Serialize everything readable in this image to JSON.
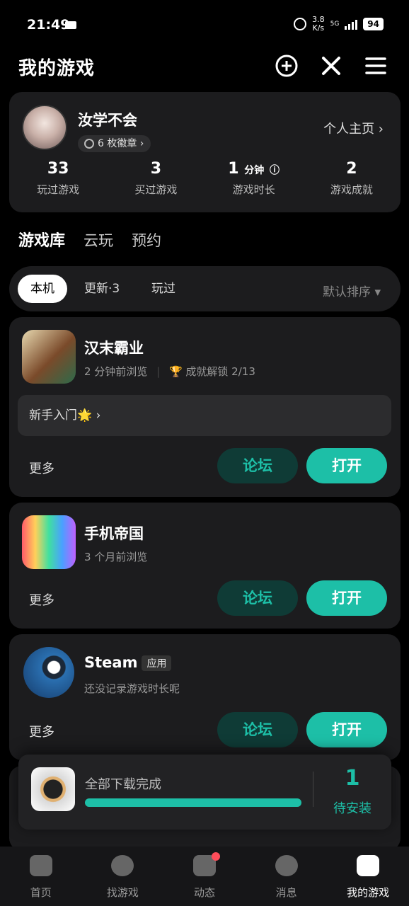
{
  "status": {
    "time": "21:49",
    "speed_top": "3.8",
    "speed_bottom": "K/s",
    "net": "5G",
    "battery": "94"
  },
  "header": {
    "title": "我的游戏"
  },
  "profile": {
    "name": "汝学不会",
    "badge": "6 枚徽章",
    "home_link": "个人主页",
    "stats": [
      {
        "value": "33",
        "unit": "",
        "label": "玩过游戏"
      },
      {
        "value": "3",
        "unit": "",
        "label": "买过游戏"
      },
      {
        "value": "1",
        "unit": "分钟",
        "label": "游戏时长"
      },
      {
        "value": "2",
        "unit": "",
        "label": "游戏成就"
      }
    ]
  },
  "tabs": [
    "游戏库",
    "云玩",
    "预约"
  ],
  "filters": {
    "local": "本机",
    "updates": "更新·3",
    "played": "玩过",
    "sort": "默认排序"
  },
  "games": [
    {
      "name": "汉末霸业",
      "sub": "2 分钟前浏览",
      "achievement": "成就解锁 2/13",
      "guide": "新手入门🌟",
      "more": "更多",
      "forum": "论坛",
      "open": "打开"
    },
    {
      "name": "手机帝国",
      "sub": "3 个月前浏览",
      "more": "更多",
      "forum": "论坛",
      "open": "打开"
    },
    {
      "name": "Steam",
      "tag": "应用",
      "sub": "还没记录游戏时长呢",
      "more": "更多",
      "forum": "论坛",
      "open": "打开"
    }
  ],
  "download": {
    "text": "全部下载完成",
    "progress": 1.0,
    "count": "1",
    "count_label": "待安装"
  },
  "nav": [
    {
      "label": "首页"
    },
    {
      "label": "找游戏"
    },
    {
      "label": "动态"
    },
    {
      "label": "消息"
    },
    {
      "label": "我的游戏"
    }
  ],
  "colors": {
    "accent": "#1dbfa7",
    "card": "#1c1c1e",
    "badge_dot": "#ff4d5a"
  }
}
